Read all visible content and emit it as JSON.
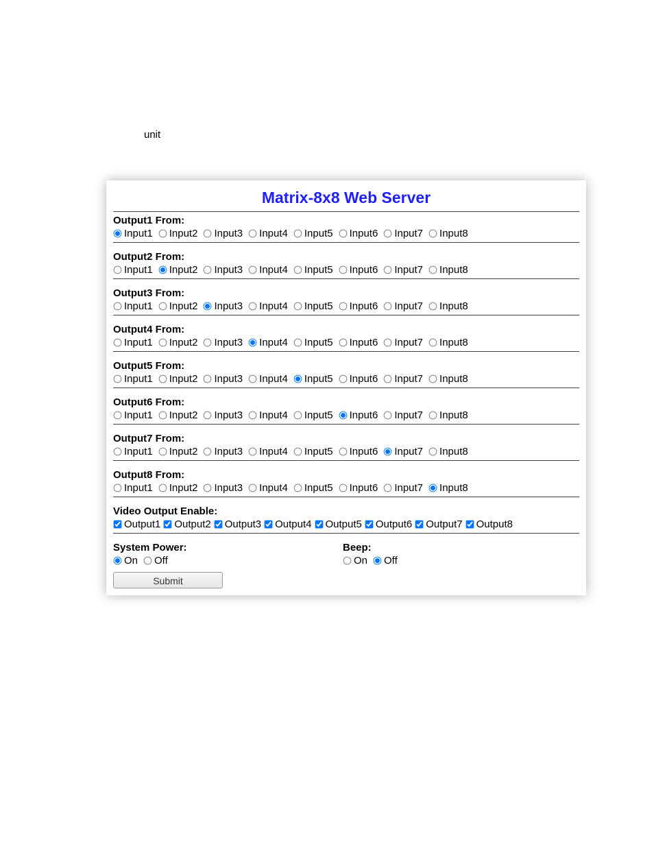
{
  "stray_text": "unit",
  "panel": {
    "title": "Matrix-8x8 Web Server"
  },
  "outputs": [
    {
      "label": "Output1 From:",
      "options": [
        "Input1",
        "Input2",
        "Input3",
        "Input4",
        "Input5",
        "Input6",
        "Input7",
        "Input8"
      ],
      "selected": 0
    },
    {
      "label": "Output2 From:",
      "options": [
        "Input1",
        "Input2",
        "Input3",
        "Input4",
        "Input5",
        "Input6",
        "Input7",
        "Input8"
      ],
      "selected": 1
    },
    {
      "label": "Output3 From:",
      "options": [
        "Input1",
        "Input2",
        "Input3",
        "Input4",
        "Input5",
        "Input6",
        "Input7",
        "Input8"
      ],
      "selected": 2
    },
    {
      "label": "Output4 From:",
      "options": [
        "Input1",
        "Input2",
        "Input3",
        "Input4",
        "Input5",
        "Input6",
        "Input7",
        "Input8"
      ],
      "selected": 3
    },
    {
      "label": "Output5 From:",
      "options": [
        "Input1",
        "Input2",
        "Input3",
        "Input4",
        "Input5",
        "Input6",
        "Input7",
        "Input8"
      ],
      "selected": 4
    },
    {
      "label": "Output6 From:",
      "options": [
        "Input1",
        "Input2",
        "Input3",
        "Input4",
        "Input5",
        "Input6",
        "Input7",
        "Input8"
      ],
      "selected": 5
    },
    {
      "label": "Output7 From:",
      "options": [
        "Input1",
        "Input2",
        "Input3",
        "Input4",
        "Input5",
        "Input6",
        "Input7",
        "Input8"
      ],
      "selected": 6
    },
    {
      "label": "Output8 From:",
      "options": [
        "Input1",
        "Input2",
        "Input3",
        "Input4",
        "Input5",
        "Input6",
        "Input7",
        "Input8"
      ],
      "selected": 7
    }
  ],
  "video_enable": {
    "label": "Video Output Enable:",
    "options": [
      "Output1",
      "Output2",
      "Output3",
      "Output4",
      "Output5",
      "Output6",
      "Output7",
      "Output8"
    ],
    "checked": [
      true,
      true,
      true,
      true,
      true,
      true,
      true,
      true
    ]
  },
  "system_power": {
    "label": "System Power:",
    "options": [
      "On",
      "Off"
    ],
    "selected": 0
  },
  "beep": {
    "label": "Beep:",
    "options": [
      "On",
      "Off"
    ],
    "selected": 1
  },
  "buttons": {
    "submit": "Submit"
  }
}
